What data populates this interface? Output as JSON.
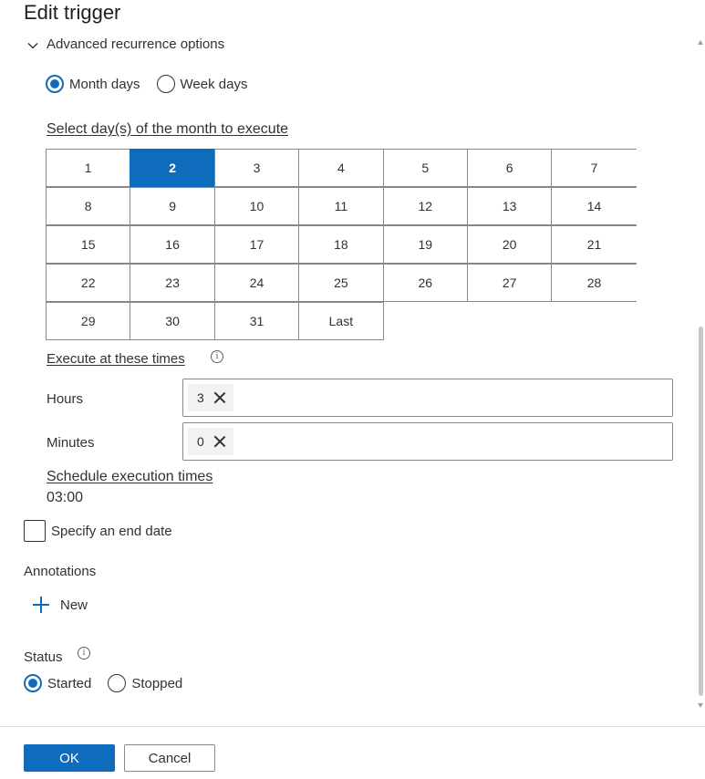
{
  "panel": {
    "title": "Edit trigger"
  },
  "advanced": {
    "header": "Advanced recurrence options",
    "mode_options": [
      {
        "label": "Month days",
        "checked": true
      },
      {
        "label": "Week days",
        "checked": false
      }
    ],
    "days_label": "Select day(s) of the month to execute",
    "days": [
      [
        "1",
        "2",
        "3",
        "4",
        "5",
        "6",
        "7"
      ],
      [
        "8",
        "9",
        "10",
        "11",
        "12",
        "13",
        "14"
      ],
      [
        "15",
        "16",
        "17",
        "18",
        "19",
        "20",
        "21"
      ],
      [
        "22",
        "23",
        "24",
        "25",
        "26",
        "27",
        "28"
      ],
      [
        "29",
        "30",
        "31",
        "Last"
      ]
    ],
    "selected_days": [
      "2"
    ],
    "times_label": "Execute at these times",
    "info_glyph": "i",
    "hours_label": "Hours",
    "hours_values": [
      "3"
    ],
    "minutes_label": "Minutes",
    "minutes_values": [
      "0"
    ],
    "schedule_label": "Schedule execution times",
    "schedule_value": "03:00"
  },
  "end_date": {
    "label": "Specify an end date",
    "checked": false
  },
  "annotations": {
    "label": "Annotations",
    "new_label": "New"
  },
  "status": {
    "label": "Status",
    "options": [
      {
        "label": "Started",
        "checked": true
      },
      {
        "label": "Stopped",
        "checked": false
      }
    ]
  },
  "footer": {
    "ok_label": "OK",
    "cancel_label": "Cancel"
  },
  "colors": {
    "accent": "#0f6cbd",
    "text": "#323130",
    "border": "#8a8886"
  }
}
